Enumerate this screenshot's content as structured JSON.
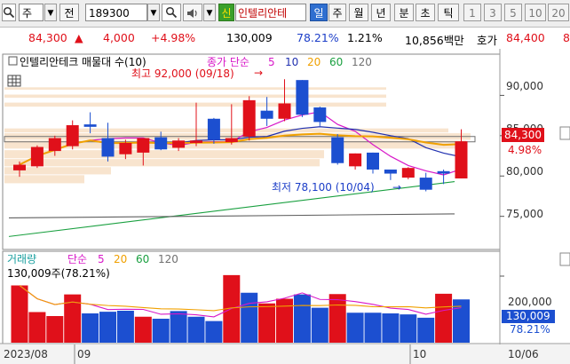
{
  "toolbar": {
    "market": "주",
    "all_label": "전",
    "code": "189300",
    "signal_label": "신",
    "stock_name": "인텔리안테",
    "periods": [
      "일",
      "주",
      "월",
      "년",
      "분",
      "초",
      "틱"
    ],
    "selected_period": "일",
    "intervals": [
      "1",
      "3",
      "5",
      "10",
      "20"
    ]
  },
  "quote": {
    "price": "84,300",
    "change": "4,000",
    "change_pct": "+4.98%",
    "volume": "130,009",
    "volume_ratio": "78.21%",
    "turnover": "1.21%",
    "amount": "10,856백만",
    "ask_label": "호가",
    "ask_price": "84,400",
    "ask_cut": "8"
  },
  "price_chart": {
    "legend_title": "인텔리안테크 매물대 수(10)",
    "legend_ma_label": "종가 단순",
    "legend_ma_periods": [
      "5",
      "10",
      "20",
      "60",
      "120"
    ],
    "high_annotation": "최고 92,000 (09/18)",
    "low_annotation": "최저 78,100 (10/04)",
    "current_price_tag": "84,300",
    "current_pct_tag": "4.98%",
    "y_ticks": [
      "90,000",
      "85,000",
      "80,000",
      "75,000"
    ]
  },
  "volume_chart": {
    "legend_title": "거래량",
    "legend_ma_label": "단순",
    "legend_ma_periods": [
      "5",
      "20",
      "60",
      "120"
    ],
    "volume_line": "130,009주(78.21%)",
    "y_ticks": [
      "200,000"
    ],
    "current_volume_tag": "130,009",
    "current_pct_tag": "78.21%"
  },
  "x_axis": {
    "labels": [
      "2023/08",
      "09",
      "10",
      "10/06"
    ]
  },
  "colors": {
    "up": "#e0101a",
    "down": "#1c4fd0",
    "ma5": "#d818c8",
    "ma10": "#2030b0",
    "ma20": "#f0a000",
    "ma60": "#1aa040",
    "ma120": "#606060"
  },
  "chart_data": [
    {
      "type": "candlestick",
      "title": "인텔리안테크",
      "y_range": [
        71000,
        95000
      ],
      "candles": [
        {
          "o": 80700,
          "h": 81800,
          "l": 79900,
          "c": 81400
        },
        {
          "o": 81200,
          "h": 83800,
          "l": 81000,
          "c": 83600
        },
        {
          "o": 83100,
          "h": 85000,
          "l": 82500,
          "c": 84700
        },
        {
          "o": 83700,
          "h": 86900,
          "l": 83300,
          "c": 86300
        },
        {
          "o": 86400,
          "h": 87900,
          "l": 85300,
          "c": 86100
        },
        {
          "o": 84700,
          "h": 86600,
          "l": 81800,
          "c": 82400
        },
        {
          "o": 82700,
          "h": 84500,
          "l": 82100,
          "c": 84100
        },
        {
          "o": 82900,
          "h": 83900,
          "l": 81300,
          "c": 84700
        },
        {
          "o": 84800,
          "h": 85500,
          "l": 83200,
          "c": 83300
        },
        {
          "o": 83500,
          "h": 84700,
          "l": 83100,
          "c": 84400
        },
        {
          "o": 84100,
          "h": 89100,
          "l": 83700,
          "c": 84400
        },
        {
          "o": 87100,
          "h": 87200,
          "l": 84000,
          "c": 84500
        },
        {
          "o": 84200,
          "h": 88900,
          "l": 83900,
          "c": 84700
        },
        {
          "o": 84900,
          "h": 89900,
          "l": 84400,
          "c": 89400
        },
        {
          "o": 88100,
          "h": 89800,
          "l": 86200,
          "c": 87100
        },
        {
          "o": 87100,
          "h": 92000,
          "l": 86800,
          "c": 89000
        },
        {
          "o": 91900,
          "h": 91900,
          "l": 87300,
          "c": 87600
        },
        {
          "o": 88500,
          "h": 88600,
          "l": 86200,
          "c": 86700
        },
        {
          "o": 84800,
          "h": 85200,
          "l": 81400,
          "c": 81600
        },
        {
          "o": 81200,
          "h": 82800,
          "l": 80800,
          "c": 82800
        },
        {
          "o": 82900,
          "h": 82900,
          "l": 80300,
          "c": 80800
        },
        {
          "o": 80800,
          "h": 80800,
          "l": 79500,
          "c": 80300
        },
        {
          "o": 79800,
          "h": 81100,
          "l": 79600,
          "c": 81000
        },
        {
          "o": 79800,
          "h": 80400,
          "l": 78100,
          "c": 78300
        },
        {
          "o": 80600,
          "h": 80800,
          "l": 79000,
          "c": 80300
        },
        {
          "o": 79700,
          "h": 85800,
          "l": 79700,
          "c": 84300
        }
      ]
    },
    {
      "type": "bar",
      "title": "거래량",
      "y_range": [
        0,
        272000
      ],
      "values": [
        172000,
        92000,
        80000,
        145000,
        88000,
        93000,
        96000,
        78000,
        72000,
        95000,
        78000,
        65000,
        203000,
        150000,
        118000,
        132000,
        145000,
        105000,
        146000,
        90000,
        90000,
        88000,
        85000,
        75000,
        147000,
        130009
      ],
      "up": [
        true,
        true,
        true,
        true,
        false,
        false,
        false,
        true,
        false,
        false,
        false,
        false,
        true,
        false,
        true,
        true,
        false,
        false,
        true,
        false,
        false,
        false,
        false,
        false,
        true,
        false
      ]
    }
  ]
}
